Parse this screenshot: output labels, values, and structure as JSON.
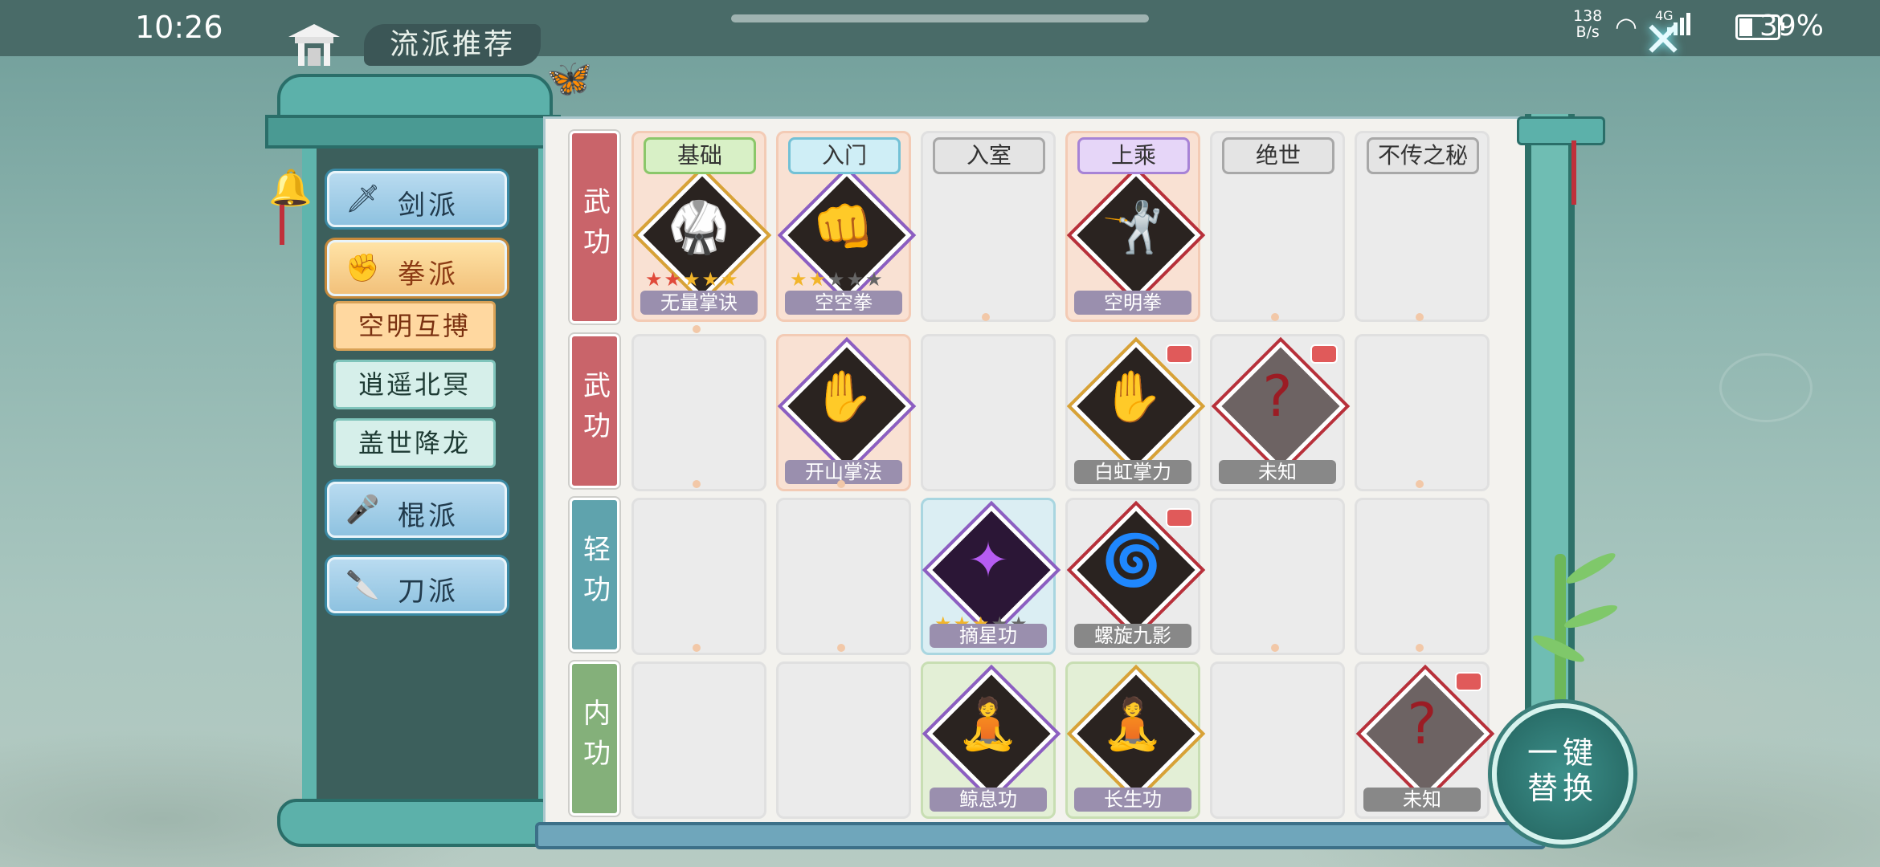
{
  "status": {
    "time": "10:26",
    "net_speed_top": "138",
    "net_speed_bottom": "B/s",
    "signal_label": "4G",
    "battery": "39%"
  },
  "header": {
    "title": "流派推荐"
  },
  "schools": [
    {
      "label": "剑派",
      "icon": "sword-icon",
      "active": false
    },
    {
      "label": "拳派",
      "icon": "fist-icon",
      "active": true
    },
    {
      "label": "棍派",
      "icon": "staff-icon",
      "active": false
    },
    {
      "label": "刀派",
      "icon": "blade-icon",
      "active": false
    }
  ],
  "sub_styles": [
    {
      "label": "空明互搏",
      "active": true
    },
    {
      "label": "逍遥北冥",
      "active": false
    },
    {
      "label": "盖世降龙",
      "active": false
    }
  ],
  "tiers": [
    {
      "label": "基础",
      "color": "#d8f0c6",
      "border": "#8bc76a"
    },
    {
      "label": "入门",
      "color": "#cfeef6",
      "border": "#73c1d6"
    },
    {
      "label": "入室",
      "color": "#e4e4e4",
      "border": "#a8a8a8"
    },
    {
      "label": "上乘",
      "color": "#e6d6f8",
      "border": "#a783d6"
    },
    {
      "label": "绝世",
      "color": "#e4e4e4",
      "border": "#a8a8a8"
    },
    {
      "label": "不传之秘",
      "color": "#e4e4e4",
      "border": "#a8a8a8"
    }
  ],
  "rows": [
    {
      "label": "武功",
      "color": "#c9646a"
    },
    {
      "label": "武功",
      "color": "#c9646a"
    },
    {
      "label": "轻功",
      "color": "#5fa3ad"
    },
    {
      "label": "内功",
      "color": "#84b07a"
    }
  ],
  "skills": {
    "r0c0": {
      "name": "无量掌诀",
      "stars": "★★★★★"
    },
    "r0c1": {
      "name": "空空拳",
      "stars": "★★★★★"
    },
    "r0c3": {
      "name": "空明拳"
    },
    "r1c1": {
      "name": "开山掌法"
    },
    "r1c3": {
      "name": "白虹掌力"
    },
    "r1c4": {
      "name": "未知",
      "glyph": "?"
    },
    "r2c2": {
      "name": "摘星功",
      "stars": "★★★★★"
    },
    "r2c3": {
      "name": "螺旋九影"
    },
    "r3c2": {
      "name": "鲸息功"
    },
    "r3c3": {
      "name": "长生功"
    },
    "r3c5": {
      "name": "未知",
      "glyph": "?"
    }
  },
  "onekey": {
    "line1": "一键",
    "line2": "替换"
  }
}
